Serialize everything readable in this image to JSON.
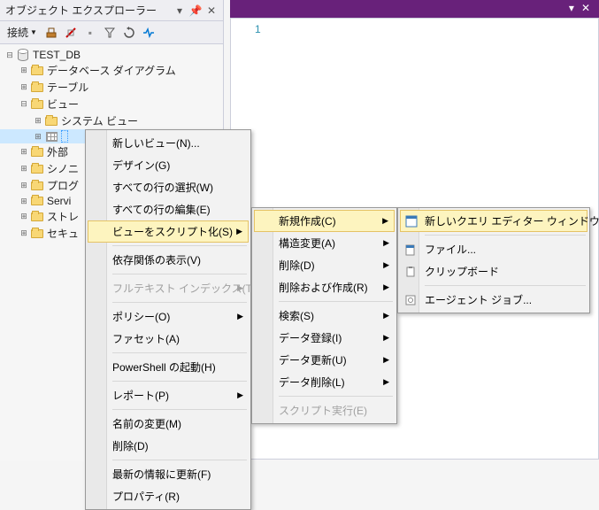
{
  "panel": {
    "title": "オブジェクト エクスプローラー",
    "connect_label": "接続"
  },
  "tree": {
    "db": "TEST_DB",
    "items": [
      "データベース ダイアグラム",
      "テーブル",
      "ビュー",
      "システム ビュー",
      "外部",
      "シノニ",
      "プログ",
      "Servi",
      "ストレ",
      "セキュ"
    ]
  },
  "editor": {
    "line": "1"
  },
  "menu1": {
    "items": [
      "新しいビュー(N)...",
      "デザイン(G)",
      "すべての行の選択(W)",
      "すべての行の編集(E)",
      "ビューをスクリプト化(S)",
      "依存関係の表示(V)",
      "フルテキスト インデックス(T)",
      "ポリシー(O)",
      "ファセット(A)",
      "PowerShell の起動(H)",
      "レポート(P)",
      "名前の変更(M)",
      "削除(D)",
      "最新の情報に更新(F)",
      "プロパティ(R)"
    ]
  },
  "menu2": {
    "items": [
      "新規作成(C)",
      "構造変更(A)",
      "削除(D)",
      "削除および作成(R)",
      "検索(S)",
      "データ登録(I)",
      "データ更新(U)",
      "データ削除(L)",
      "スクリプト実行(E)"
    ]
  },
  "menu3": {
    "items": [
      "新しいクエリ エディター ウィンドウ",
      "ファイル...",
      "クリップボード",
      "エージェント ジョブ..."
    ]
  }
}
